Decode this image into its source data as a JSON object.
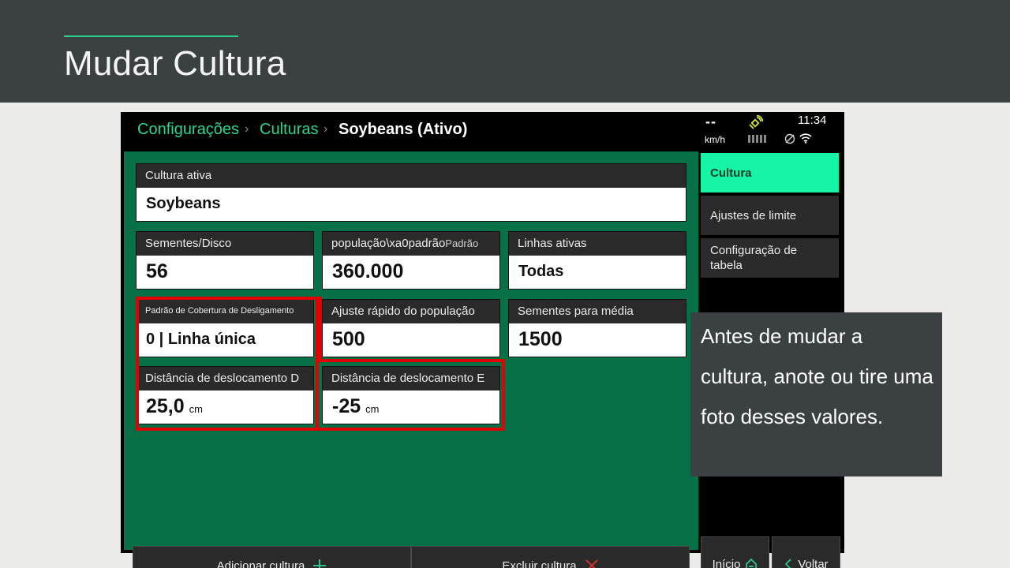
{
  "slide": {
    "title": "Mudar Cultura",
    "callout_text": "Antes de mudar a cultura, anote ou tire uma foto desses valores."
  },
  "colors": {
    "accent_green": "#2bd48f",
    "panel_green": "#077047",
    "active_tab": "#16f5a6",
    "highlight_red": "#e10000",
    "header_dark": "#3b4043"
  },
  "breadcrumb": {
    "items": [
      "Configurações",
      "Culturas"
    ],
    "current": "Soybeans (Ativo)"
  },
  "status": {
    "speed": "--",
    "speed_unit": "km/h",
    "time": "11:34",
    "icons": [
      "satellite-icon",
      "signal-bars-icon",
      "network-icon",
      "wifi-icon"
    ]
  },
  "fields": {
    "active_crop": {
      "label": "Cultura ativa",
      "value": "Soybeans"
    },
    "seeds_disc": {
      "label": "Sementes/Disco",
      "value": "56"
    },
    "population": {
      "label": "população\\xa0padrão",
      "label_sub": "Padrão",
      "value": "360.000"
    },
    "active_rows": {
      "label": "Linhas ativas",
      "value": "Todas"
    },
    "shutoff_pattern": {
      "label": "Padrão de Cobertura de Desligamento",
      "value": "0 | Linha única"
    },
    "population_adjust": {
      "label": "Ajuste rápido do população",
      "value": "500"
    },
    "seeds_average": {
      "label": "Sementes para média",
      "value": "1500"
    },
    "offset_right": {
      "label": "Distância de deslocamento D",
      "value": "25,0",
      "unit": "cm"
    },
    "offset_left": {
      "label": "Distância de deslocamento E",
      "value": "-25",
      "unit": "cm"
    }
  },
  "buttons": {
    "add_crop": "Adicionar cultura",
    "delete_crop": "Excluir cultura",
    "home": "Início",
    "back": "Voltar"
  },
  "sidebar": {
    "items": [
      {
        "label": "Cultura",
        "active": true
      },
      {
        "label": "Ajustes de limite",
        "active": false
      },
      {
        "label": "Configuração de tabela",
        "active": false
      }
    ]
  }
}
